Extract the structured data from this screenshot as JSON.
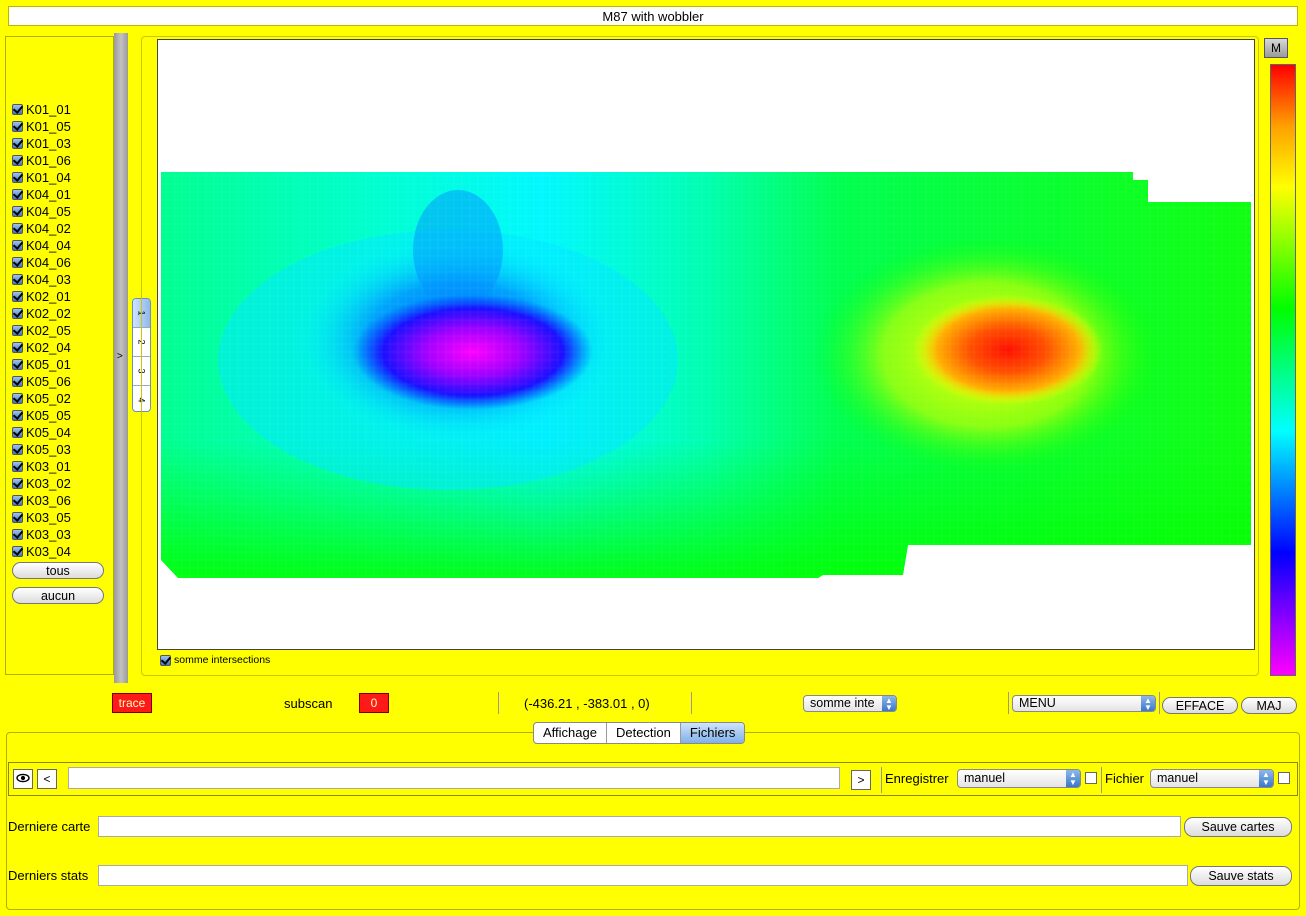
{
  "window": {
    "title": "M87 with wobbler"
  },
  "channels": [
    {
      "label": "K01_01",
      "checked": true
    },
    {
      "label": "K01_05",
      "checked": true
    },
    {
      "label": "K01_03",
      "checked": true
    },
    {
      "label": "K01_06",
      "checked": true
    },
    {
      "label": "K01_04",
      "checked": true
    },
    {
      "label": "K04_01",
      "checked": true
    },
    {
      "label": "K04_05",
      "checked": true
    },
    {
      "label": "K04_02",
      "checked": true
    },
    {
      "label": "K04_04",
      "checked": true
    },
    {
      "label": "K04_06",
      "checked": true
    },
    {
      "label": "K04_03",
      "checked": true
    },
    {
      "label": "K02_01",
      "checked": true
    },
    {
      "label": "K02_02",
      "checked": true
    },
    {
      "label": "K02_05",
      "checked": true
    },
    {
      "label": "K02_04",
      "checked": true
    },
    {
      "label": "K05_01",
      "checked": true
    },
    {
      "label": "K05_06",
      "checked": true
    },
    {
      "label": "K05_02",
      "checked": true
    },
    {
      "label": "K05_05",
      "checked": true
    },
    {
      "label": "K05_04",
      "checked": true
    },
    {
      "label": "K05_03",
      "checked": true
    },
    {
      "label": "K03_01",
      "checked": true
    },
    {
      "label": "K03_02",
      "checked": true
    },
    {
      "label": "K03_06",
      "checked": true
    },
    {
      "label": "K03_05",
      "checked": true
    },
    {
      "label": "K03_03",
      "checked": true
    },
    {
      "label": "K03_04",
      "checked": true
    }
  ],
  "left": {
    "all_label": "tous",
    "none_label": "aucun",
    "collapse_arrow": ">"
  },
  "pager": {
    "tabs": [
      "1",
      "2",
      "3",
      "4"
    ],
    "active": 0
  },
  "map": {
    "sum_intersections_label": "somme intersections",
    "sum_intersections_checked": true
  },
  "colorbar": {
    "mode_label": "M",
    "colors": [
      "#ff00ff",
      "#8000ff",
      "#0000ff",
      "#0080ff",
      "#00ffff",
      "#00ff80",
      "#00ff00",
      "#80ff00",
      "#ffff00",
      "#ffa000",
      "#ff0000"
    ]
  },
  "status": {
    "trace_label": "trace",
    "subscan_label": "subscan",
    "subscan_value": "0",
    "coords": "(-436.21 , -383.01 , 0)",
    "sum_select": "somme inte",
    "menu_select": "MENU",
    "erase_label": "EFFACE",
    "update_label": "MAJ"
  },
  "tabs": [
    {
      "label": "Affichage",
      "active": false
    },
    {
      "label": "Detection",
      "active": false
    },
    {
      "label": "Fichiers",
      "active": true
    }
  ],
  "files": {
    "eye_icon": "eye-icon",
    "prev_label": "<",
    "next_label": ">",
    "path_value": "",
    "save_label": "Enregistrer",
    "save_mode": "manuel",
    "file_label": "Fichier",
    "file_mode": "manuel",
    "last_map_label": "Derniere carte",
    "last_map_value": "",
    "save_maps_label": "Sauve cartes",
    "last_stats_label": "Derniers stats",
    "last_stats_value": "",
    "save_stats_label": "Sauve stats"
  }
}
